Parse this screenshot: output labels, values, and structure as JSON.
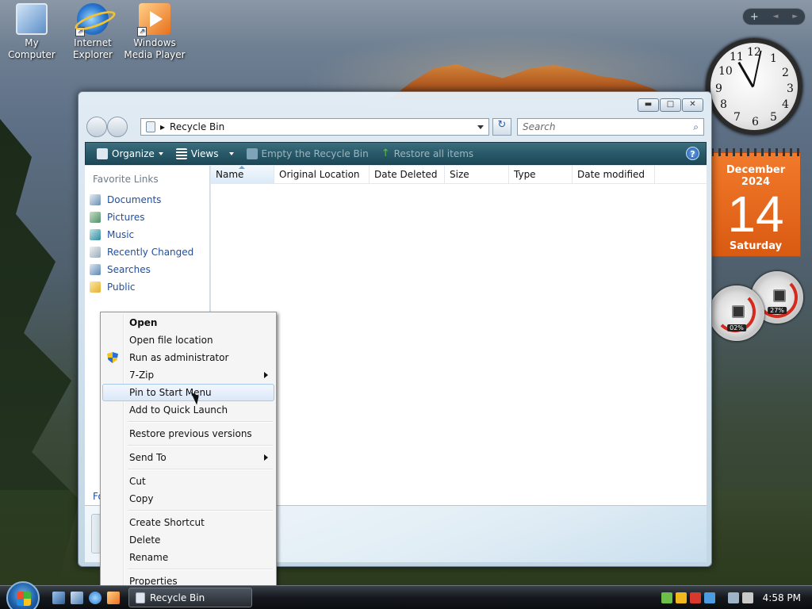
{
  "desktop": {
    "icons": [
      {
        "label_line1": "My Computer",
        "label_line2": ""
      },
      {
        "label_line1": "Internet",
        "label_line2": "Explorer"
      },
      {
        "label_line1": "Windows",
        "label_line2": "Media Player"
      }
    ]
  },
  "gadgets": {
    "bar_add": "+",
    "bar_prev": "◄",
    "bar_next": "►",
    "clock": {
      "numbers": [
        "12",
        "1",
        "2",
        "3",
        "4",
        "5",
        "6",
        "7",
        "8",
        "9",
        "10",
        "11"
      ]
    },
    "calendar": {
      "month": "December 2024",
      "day": "14",
      "weekday": "Saturday"
    },
    "meters": {
      "cpu": "02%",
      "memory": "27%"
    }
  },
  "window": {
    "controls": {
      "minimize": "▬",
      "maximize": "□",
      "close": "✕"
    },
    "address": {
      "separator": "▸",
      "location": "Recycle Bin"
    },
    "search": {
      "placeholder": "Search"
    },
    "toolbar": {
      "organize": "Organize",
      "views": "Views",
      "empty": "Empty the Recycle Bin",
      "restore": "Restore all items",
      "help": "?"
    },
    "nav": {
      "header": "Favorite Links",
      "links": [
        "Documents",
        "Pictures",
        "Music",
        "Recently Changed",
        "Searches",
        "Public"
      ],
      "folders_stub": "Fo"
    },
    "columns": [
      "Name",
      "Original Location",
      "Date Deleted",
      "Size",
      "Type",
      "Date modified"
    ]
  },
  "context_menu": {
    "items": [
      {
        "label": "Open"
      },
      {
        "label": "Open file location"
      },
      {
        "label": "Run as administrator"
      },
      {
        "label": "7-Zip"
      },
      {
        "label": "Pin to Start Menu"
      },
      {
        "label": "Add to Quick Launch"
      },
      {
        "label": "Restore previous versions"
      },
      {
        "label": "Send To"
      },
      {
        "label": "Cut"
      },
      {
        "label": "Copy"
      },
      {
        "label": "Create Shortcut"
      },
      {
        "label": "Delete"
      },
      {
        "label": "Rename"
      },
      {
        "label": "Properties"
      }
    ]
  },
  "taskbar": {
    "task_label": "Recycle Bin",
    "time": "4:58 PM"
  },
  "colors": {
    "toolbar": "#295969",
    "link": "#1e4fa3",
    "calendar": "#e66a1c",
    "menu_hover": "#dbe8f8"
  }
}
